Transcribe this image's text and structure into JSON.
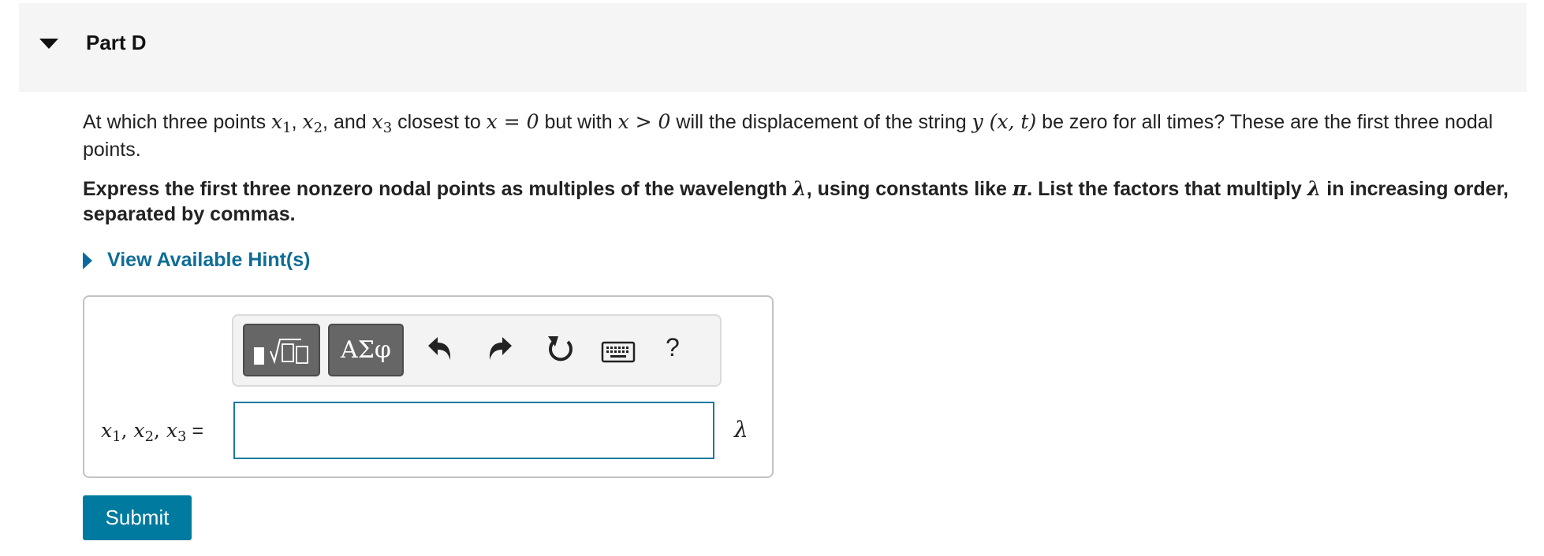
{
  "part": {
    "title": "Part D"
  },
  "question": {
    "t1": "At which three points ",
    "x1": "x",
    "x1_sub": "1",
    "c1": ", ",
    "x2": "x",
    "x2_sub": "2",
    "c2": ", and ",
    "x3": "x",
    "x3_sub": "3",
    "t2": " closest to ",
    "cond1": "x = 0",
    "t3": " but with ",
    "cond2": "x > 0",
    "t4": " will the displacement of the string ",
    "func": "y (x, t)",
    "t5": " be zero for all times? These are the first three nodal points."
  },
  "instruction": {
    "t1": "Express the first three nonzero nodal points as multiples of the wavelength ",
    "lambda": "λ",
    "t2": ", using constants like ",
    "pi": "π",
    "t3": ". List the factors that multiply ",
    "lambda2": "λ",
    "t4": " in increasing order, separated by commas."
  },
  "hint": {
    "label": "View Available Hint(s)"
  },
  "toolbar": {
    "greek_label": "ΑΣφ",
    "help_label": "?",
    "icons": [
      "templates-icon",
      "undo-icon",
      "redo-icon",
      "reset-icon",
      "keyboard-icon",
      "help-icon"
    ]
  },
  "answer": {
    "label_x1": "x",
    "label_s1": "1",
    "label_x2": "x",
    "label_s2": "2",
    "label_x3": "x",
    "label_s3": "3",
    "label_eq": "=",
    "value": "",
    "unit": "λ"
  },
  "submit": {
    "label": "Submit"
  },
  "colors": {
    "accent": "#007a9f",
    "link": "#0e6d97",
    "header_bg": "#f5f5f5",
    "tool_dark": "#666666"
  }
}
